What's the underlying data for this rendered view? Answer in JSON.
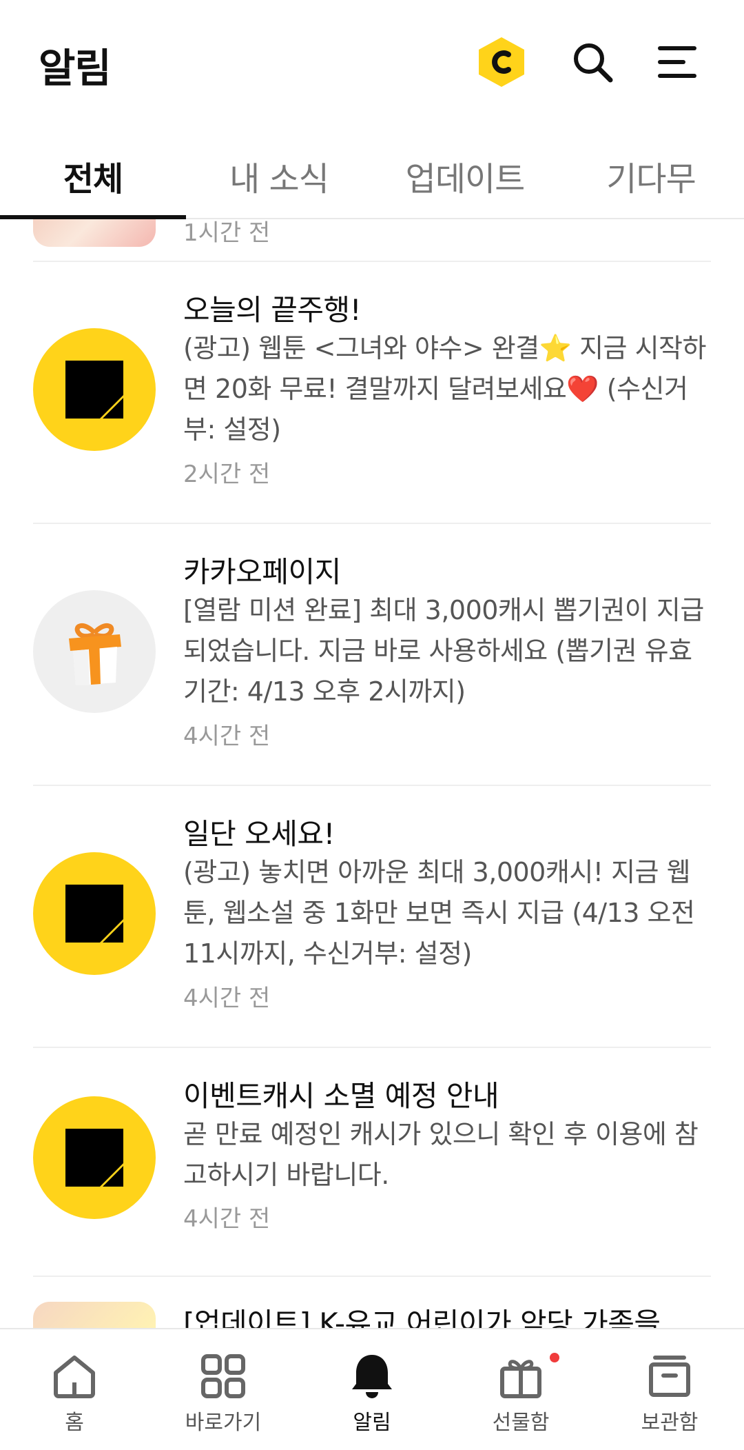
{
  "header": {
    "title": "알림",
    "cash_icon": "cash-coin-icon",
    "search_icon": "search-icon",
    "menu_icon": "menu-icon",
    "accent_color": "#FFD31A"
  },
  "tabs": [
    {
      "label": "전체",
      "active": true
    },
    {
      "label": "내 소식",
      "active": false
    },
    {
      "label": "업데이트",
      "active": false
    },
    {
      "label": "기다무",
      "active": false
    }
  ],
  "partial_top": {
    "time": "1시간 전"
  },
  "notifications": [
    {
      "title": "오늘의 끝주행!",
      "body": "(광고) 웹툰 <그녀와 야수> 완결⭐ 지금 시작하면 20화 무료! 결말까지 달려보세요❤️ (수신거부: 설정)",
      "time": "2시간 전",
      "icon": "kakaopage-logo-icon"
    },
    {
      "title": "카카오페이지",
      "body": "[열람 미션 완료] 최대 3,000캐시 뽑기권이 지급되었습니다. 지금 바로 사용하세요 (뽑기권 유효기간: 4/13 오후 2시까지)",
      "time": "4시간 전",
      "icon": "gift-box-icon"
    },
    {
      "title": "일단 오세요!",
      "body": "(광고) 놓치면 아까운 최대 3,000캐시! 지금 웹툰, 웹소설 중 1화만 보면 즉시 지급 (4/13 오전 11시까지, 수신거부: 설정)",
      "time": "4시간 전",
      "icon": "kakaopage-logo-icon"
    },
    {
      "title": "이벤트캐시 소멸 예정 안내",
      "body": "곧 만료 예정인 캐시가 있으니 확인 후 이용에 참고하시기 바랍니다.",
      "time": "4시간 전",
      "icon": "kakaopage-logo-icon"
    }
  ],
  "partial_bottom": {
    "title": "[업데이트] K-유교 어린이가 악당 가족을"
  },
  "bottom_nav": [
    {
      "label": "홈",
      "icon": "home-icon",
      "active": false
    },
    {
      "label": "바로가기",
      "icon": "grid-icon",
      "active": false
    },
    {
      "label": "알림",
      "icon": "bell-icon",
      "active": true
    },
    {
      "label": "선물함",
      "icon": "gift-icon",
      "active": false,
      "badge": true
    },
    {
      "label": "보관함",
      "icon": "archive-box-icon",
      "active": false
    }
  ]
}
